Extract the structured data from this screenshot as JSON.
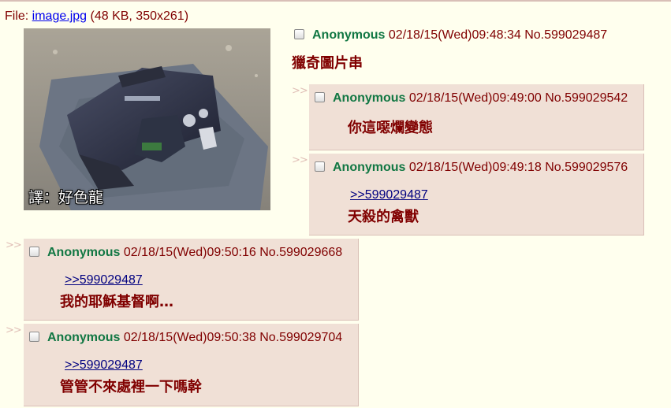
{
  "file": {
    "prefix": "File: ",
    "filename": "image.jpg",
    "details": " (48 KB, 350x261)",
    "caption": "譯：好色龍"
  },
  "op": {
    "name": "Anonymous",
    "datetime": "02/18/15(Wed)09:48:34",
    "number": "No.599029487",
    "comment": "獵奇圖片串"
  },
  "replies": [
    {
      "arrow": ">>",
      "name": "Anonymous",
      "datetime": "02/18/15(Wed)09:49:00",
      "number": "No.599029542",
      "quote": "",
      "comment": "你這噁爛變態"
    },
    {
      "arrow": ">>",
      "name": "Anonymous",
      "datetime": "02/18/15(Wed)09:49:18",
      "number": "No.599029576",
      "quote": ">>599029487",
      "comment": "天殺的禽獸"
    },
    {
      "arrow": ">>",
      "name": "Anonymous",
      "datetime": "02/18/15(Wed)09:50:16",
      "number": "No.599029668",
      "quote": ">>599029487",
      "comment": "我的耶穌基督啊…"
    },
    {
      "arrow": ">>",
      "name": "Anonymous",
      "datetime": "02/18/15(Wed)09:50:38",
      "number": "No.599029704",
      "quote": ">>599029487",
      "comment": "管管不來處裡一下嗎幹"
    }
  ],
  "colors": {
    "background": "#ffffee",
    "reply_background": "#f0e0d6",
    "name": "#117743",
    "text": "#800000",
    "quote_link": "#000080"
  },
  "icons": {
    "checkbox": "checkbox-icon",
    "reply_arrow": "reply-arrow-icon"
  }
}
